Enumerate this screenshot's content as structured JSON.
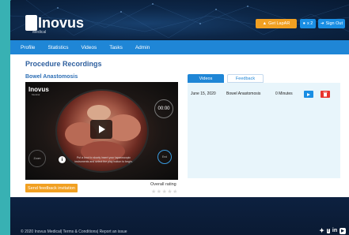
{
  "header": {
    "logo_text": "Inovus",
    "logo_sub": "Medical",
    "buttons": [
      {
        "label": "Get LapAR",
        "icon": "user-icon"
      },
      {
        "label": "x 2",
        "icon": "person-icon"
      },
      {
        "label": "Sign Out",
        "icon": "sign-out-icon"
      }
    ]
  },
  "nav": {
    "items": [
      "Profile",
      "Statistics",
      "Videos",
      "Tasks",
      "Admin"
    ]
  },
  "page": {
    "title": "Procedure Recordings",
    "recording_title": "Bowel Anastomosis"
  },
  "video": {
    "logo": "Inovus",
    "logo_sub": "Medical",
    "timer": "00:00",
    "zoom_label": "Zoom",
    "end_label": "End",
    "info_icon": "i",
    "caption": "Put a knot to slowly insert your laparoscopic instruments and select the play button to begin."
  },
  "actions": {
    "feedback_button": "Send feedback invitation",
    "rating_label": "Overall rating",
    "rating_value": 0,
    "rating_max": 5
  },
  "tabs": [
    {
      "label": "Videos",
      "active": true
    },
    {
      "label": "Feedback",
      "active": false
    }
  ],
  "recordings": [
    {
      "date": "June 15, 2020",
      "name": "Bowel Anastomosis",
      "duration": "0 Minutes"
    }
  ],
  "footer": {
    "text": "© 2020 Inovus Medical| Terms & Conditions| Report an issue",
    "social": [
      "twitter-icon",
      "facebook-icon",
      "linkedin-icon",
      "youtube-icon"
    ]
  },
  "colors": {
    "accent": "#1f86d6",
    "orange": "#f1a022",
    "danger": "#e8332c",
    "outer_bg": "#38b1b3"
  }
}
